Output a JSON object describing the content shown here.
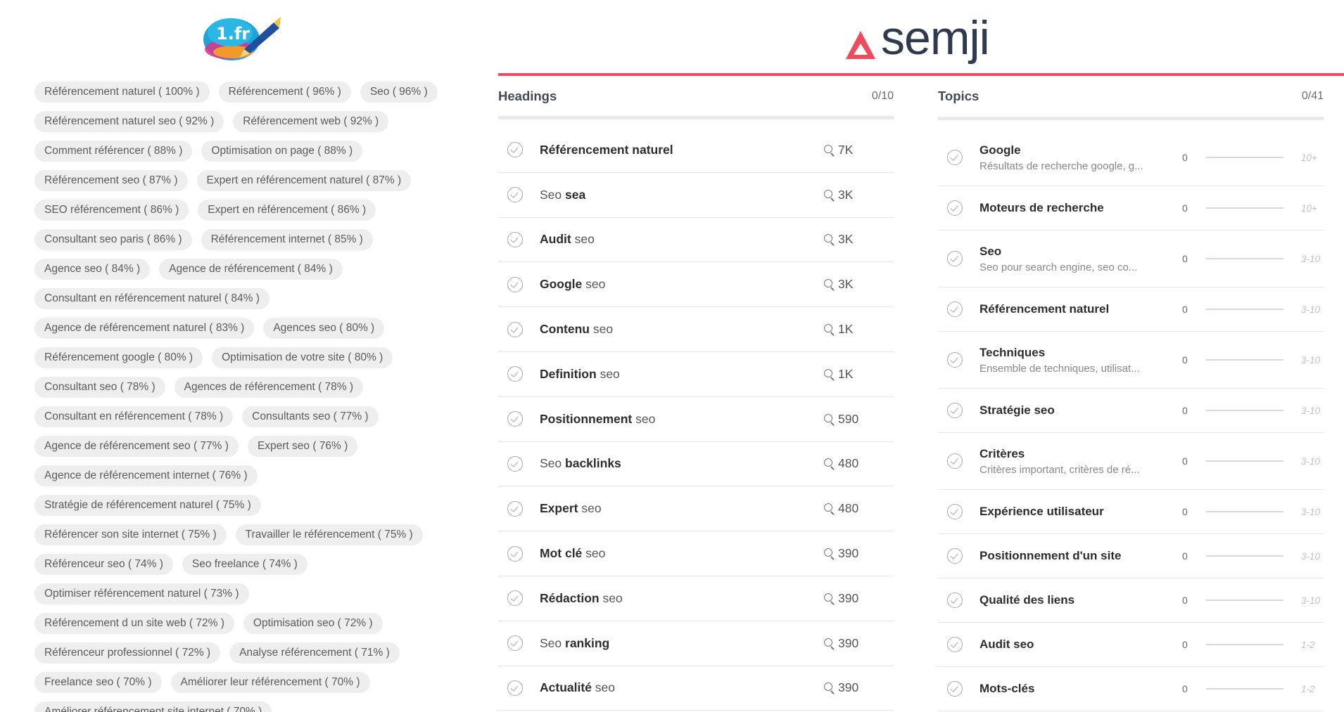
{
  "left": {
    "logo_text": "1.fr",
    "chips": [
      "Référencement naturel ( 100% )",
      "Référencement ( 96% )",
      "Seo ( 96% )",
      "Référencement naturel seo ( 92% )",
      "Référencement web ( 92% )",
      "Comment référencer ( 88% )",
      "Optimisation on page ( 88% )",
      "Référencement seo ( 87% )",
      "Expert en référencement naturel ( 87% )",
      "SEO référencement ( 86% )",
      "Expert en référencement ( 86% )",
      "Consultant seo paris ( 86% )",
      "Référencement internet ( 85% )",
      "Agence seo ( 84% )",
      "Agence de référencement ( 84% )",
      "Consultant en référencement naturel ( 84% )",
      "Agence de référencement naturel ( 83% )",
      "Agences seo ( 80% )",
      "Référencement google ( 80% )",
      "Optimisation de votre site ( 80% )",
      "Consultant seo ( 78% )",
      "Agences de référencement ( 78% )",
      "Consultant en référencement ( 78% )",
      "Consultants seo ( 77% )",
      "Agence de référencement seo ( 77% )",
      "Expert seo ( 76% )",
      "Agence de référencement internet ( 76% )",
      "Stratégie de référencement naturel ( 75% )",
      "Référencer son site internet ( 75% )",
      "Travailler le référencement ( 75% )",
      "Référenceur seo ( 74% )",
      "Seo freelance ( 74% )",
      "Optimiser référencement naturel ( 73% )",
      "Référencement d un site web ( 72% )",
      "Optimisation seo ( 72% )",
      "Référenceur professionnel ( 72% )",
      "Analyse référencement ( 71% )",
      "Freelance seo ( 70% )",
      "Améliorer leur référencement ( 70% )",
      "Améliorer référencement site internet ( 70% )"
    ]
  },
  "semji": {
    "logo_text": "semji",
    "accent_color": "#ef4b5f",
    "headings": {
      "title": "Headings",
      "count": "0/10",
      "items": [
        {
          "bold": "Référencement naturel",
          "light": "",
          "order": "bold-first",
          "volume": "7K"
        },
        {
          "bold": "sea",
          "light": "Seo",
          "order": "light-first",
          "volume": "3K"
        },
        {
          "bold": "Audit",
          "light": "seo",
          "order": "bold-first",
          "volume": "3K"
        },
        {
          "bold": "Google",
          "light": "seo",
          "order": "bold-first",
          "volume": "3K"
        },
        {
          "bold": "Contenu",
          "light": "seo",
          "order": "bold-first",
          "volume": "1K"
        },
        {
          "bold": "Definition",
          "light": "seo",
          "order": "bold-first",
          "volume": "1K"
        },
        {
          "bold": "Positionnement",
          "light": "seo",
          "order": "bold-first",
          "volume": "590"
        },
        {
          "bold": "backlinks",
          "light": "Seo",
          "order": "light-first",
          "volume": "480"
        },
        {
          "bold": "Expert",
          "light": "seo",
          "order": "bold-first",
          "volume": "480"
        },
        {
          "bold": "Mot clé",
          "light": "seo",
          "order": "bold-first",
          "volume": "390"
        },
        {
          "bold": "Rédaction",
          "light": "seo",
          "order": "bold-first",
          "volume": "390"
        },
        {
          "bold": "ranking",
          "light": "Seo",
          "order": "light-first",
          "volume": "390"
        },
        {
          "bold": "Actualité",
          "light": "seo",
          "order": "bold-first",
          "volume": "390"
        }
      ]
    },
    "topics": {
      "title": "Topics",
      "count": "0/41",
      "items": [
        {
          "title": "Google",
          "sub": "Résultats de recherche google, g...",
          "count": "0",
          "range": "10+"
        },
        {
          "title": "Moteurs de recherche",
          "sub": "",
          "count": "0",
          "range": "10+"
        },
        {
          "title": "Seo",
          "sub": "Seo pour search engine, seo co...",
          "count": "0",
          "range": "3-10"
        },
        {
          "title": "Référencement naturel",
          "sub": "",
          "count": "0",
          "range": "3-10"
        },
        {
          "title": "Techniques",
          "sub": "Ensemble de techniques, utilisat...",
          "count": "0",
          "range": "3-10"
        },
        {
          "title": "Stratégie seo",
          "sub": "",
          "count": "0",
          "range": "3-10"
        },
        {
          "title": "Critères",
          "sub": "Critères important, critères de ré...",
          "count": "0",
          "range": "3-10"
        },
        {
          "title": "Expérience utilisateur",
          "sub": "",
          "count": "0",
          "range": "3-10"
        },
        {
          "title": "Positionnement d'un site",
          "sub": "",
          "count": "0",
          "range": "3-10"
        },
        {
          "title": "Qualité des liens",
          "sub": "",
          "count": "0",
          "range": "3-10"
        },
        {
          "title": "Audit seo",
          "sub": "",
          "count": "0",
          "range": "1-2"
        },
        {
          "title": "Mots-clés",
          "sub": "",
          "count": "0",
          "range": "1-2"
        }
      ]
    }
  }
}
